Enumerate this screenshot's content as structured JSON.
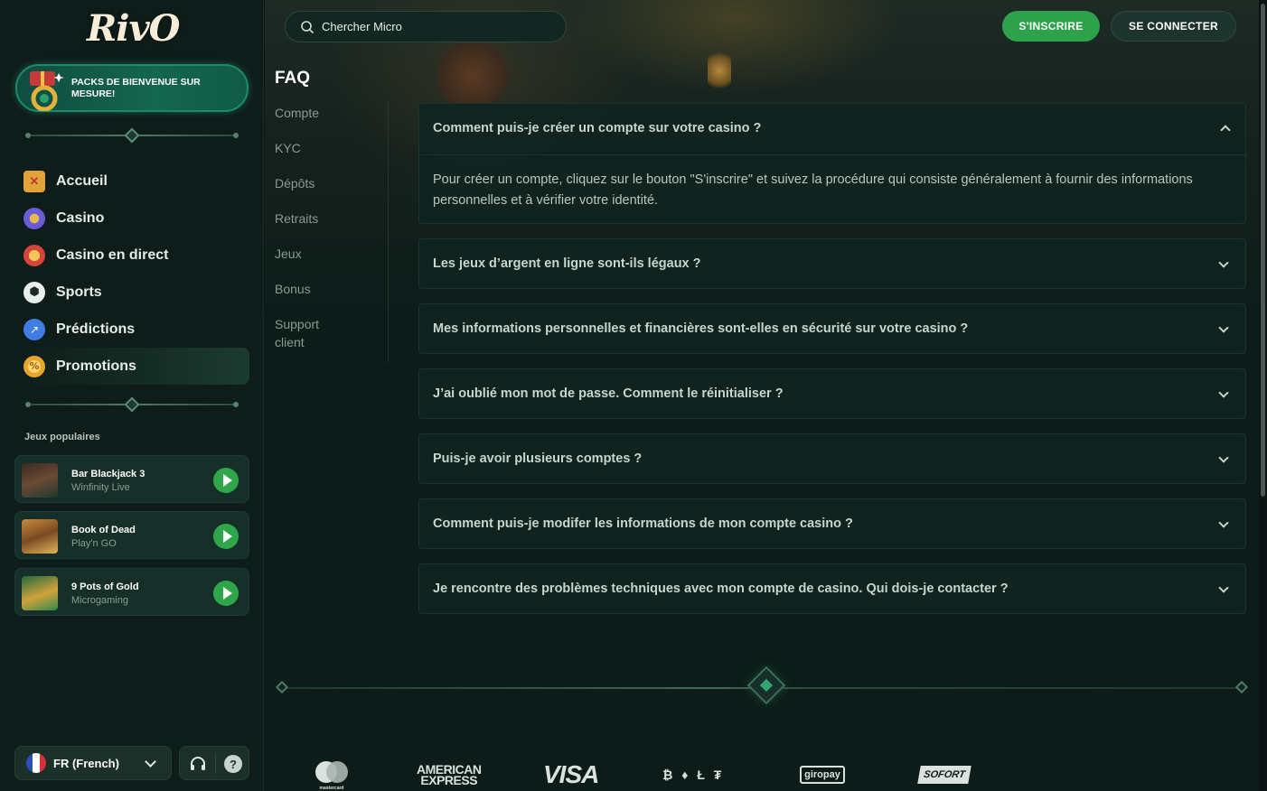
{
  "sidebar": {
    "logo": "RivO",
    "promo_banner": "PACKS DE BIENVENUE SUR MESURE!",
    "nav": [
      {
        "label": "Accueil",
        "icon": "slot-ticket-icon",
        "color": "#e2a23a"
      },
      {
        "label": "Casino",
        "icon": "casino-chip-icon",
        "color": "#6a5bd6"
      },
      {
        "label": "Casino en direct",
        "icon": "live-casino-icon",
        "color": "#d4453b"
      },
      {
        "label": "Sports",
        "icon": "soccer-ball-icon",
        "color": "#d8e2de"
      },
      {
        "label": "Prédictions",
        "icon": "predictions-icon",
        "color": "#3f7ee0"
      },
      {
        "label": "Promotions",
        "icon": "promotions-coin-icon",
        "color": "#e7a52f"
      }
    ],
    "popular_title": "Jeux populaires",
    "popular_games": [
      {
        "title": "Bar Blackjack 3",
        "provider": "Winfinity Live"
      },
      {
        "title": "Book of Dead",
        "provider": "Play'n GO"
      },
      {
        "title": "9 Pots of Gold",
        "provider": "Microgaming"
      }
    ],
    "language": "FR (French)"
  },
  "header": {
    "search_placeholder": "Chercher Micro",
    "register_label": "S'INSCRIRE",
    "login_label": "SE CONNECTER"
  },
  "faq": {
    "title": "FAQ",
    "categories": [
      "Compte",
      "KYC",
      "Dépôts",
      "Retraits",
      "Jeux",
      "Bonus",
      "Support client"
    ],
    "items": [
      {
        "question": "Comment puis-je créer un compte sur votre casino ?",
        "expanded": true,
        "answer": "Pour créer un compte, cliquez sur le bouton \"S'inscrire\" et suivez la procédure qui consiste généralement à fournir des informations personnelles et à vérifier votre identité."
      },
      {
        "question": "Les jeux d’argent en ligne sont-ils légaux ?",
        "expanded": false
      },
      {
        "question": "Mes informations personnelles et financières sont-elles en sécurité sur votre casino ?",
        "expanded": false
      },
      {
        "question": "J’ai oublié mon mot de passe. Comment le réinitialiser ?",
        "expanded": false
      },
      {
        "question": "Puis-je avoir plusieurs comptes ?",
        "expanded": false
      },
      {
        "question": "Comment puis-je modifer les informations de mon compte casino ?",
        "expanded": false
      },
      {
        "question": "Je rencontre des problèmes techniques avec mon compte de casino. Qui dois-je contacter ?",
        "expanded": false
      }
    ]
  },
  "payments": {
    "mastercard": "mastercard",
    "amex_line1": "AMERICAN",
    "amex_line2": "EXPRESS",
    "visa": "VISA",
    "crypto": "₿ ♦ Ł ₮",
    "giropay": "giropay",
    "sofort": "SOFORT"
  },
  "colors": {
    "accent_green": "#2ea24a",
    "background": "#0c1a17",
    "panel": "#10241f"
  }
}
